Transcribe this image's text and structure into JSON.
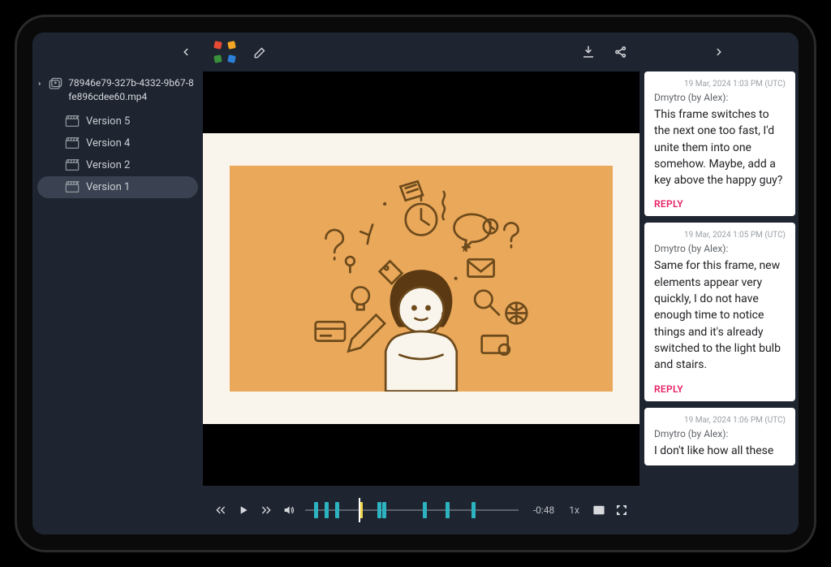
{
  "sidebar": {
    "filename": "78946e79-327b-4332-9b67-8fe896cdee60.mp4",
    "versions": [
      {
        "label": "Version 5",
        "active": false
      },
      {
        "label": "Version 4",
        "active": false
      },
      {
        "label": "Version 2",
        "active": false
      },
      {
        "label": "Version 1",
        "active": true
      }
    ]
  },
  "player": {
    "time_remaining": "-0:48",
    "speed": "1x"
  },
  "timeline": {
    "playhead_pct": 25,
    "markers": [
      {
        "pct": 4,
        "color": "teal"
      },
      {
        "pct": 9,
        "color": "teal"
      },
      {
        "pct": 14,
        "color": "teal"
      },
      {
        "pct": 25,
        "color": "yellow"
      },
      {
        "pct": 34,
        "color": "teal"
      },
      {
        "pct": 36,
        "color": "teal"
      },
      {
        "pct": 55,
        "color": "teal"
      },
      {
        "pct": 66,
        "color": "teal"
      },
      {
        "pct": 78,
        "color": "teal"
      }
    ]
  },
  "comments": [
    {
      "timestamp": "19 Mar, 2024 1:03 PM (UTC)",
      "author": "Dmytro (by Alex):",
      "body": "This frame switches to the next one too fast, I'd unite them into one somehow. Maybe, add a key above the happy guy?",
      "reply_label": "REPLY"
    },
    {
      "timestamp": "19 Mar, 2024 1:05 PM (UTC)",
      "author": "Dmytro (by Alex):",
      "body": "Same for this frame, new elements appear very quickly, I do not have enough time to notice things and it's already switched to the light bulb and stairs.",
      "reply_label": "REPLY"
    },
    {
      "timestamp": "19 Mar, 2024 1:06 PM (UTC)",
      "author": "Dmytro (by Alex):",
      "body": "I don't like how all these",
      "reply_label": "REPLY"
    }
  ]
}
